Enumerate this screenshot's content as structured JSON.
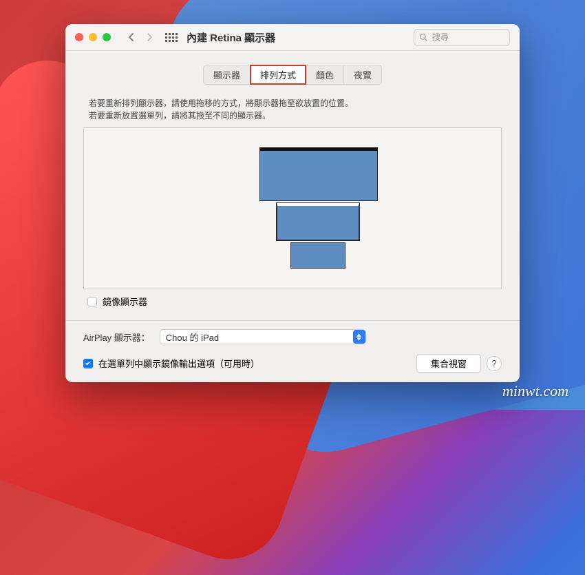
{
  "header": {
    "title": "內建 Retina 顯示器",
    "search_placeholder": "搜尋"
  },
  "tabs": [
    {
      "label": "顯示器",
      "active": false
    },
    {
      "label": "排列方式",
      "active": true
    },
    {
      "label": "顏色",
      "active": false
    },
    {
      "label": "夜覽",
      "active": false
    }
  ],
  "instructions": {
    "line1": "若要重新排列顯示器，請使用拖移的方式，將顯示器拖至欲放置的位置。",
    "line2": "若要重新放置選單列，請將其拖至不同的顯示器。"
  },
  "mirror": {
    "label": "鏡像顯示器",
    "checked": false
  },
  "airplay": {
    "label": "AirPlay 顯示器：",
    "selected": "Chou 的 iPad"
  },
  "show_mirror_option": {
    "label": "在選單列中顯示鏡像輸出選項（可用時）",
    "checked": true
  },
  "gather_button": "集合視窗",
  "watermark": "minwt.com"
}
